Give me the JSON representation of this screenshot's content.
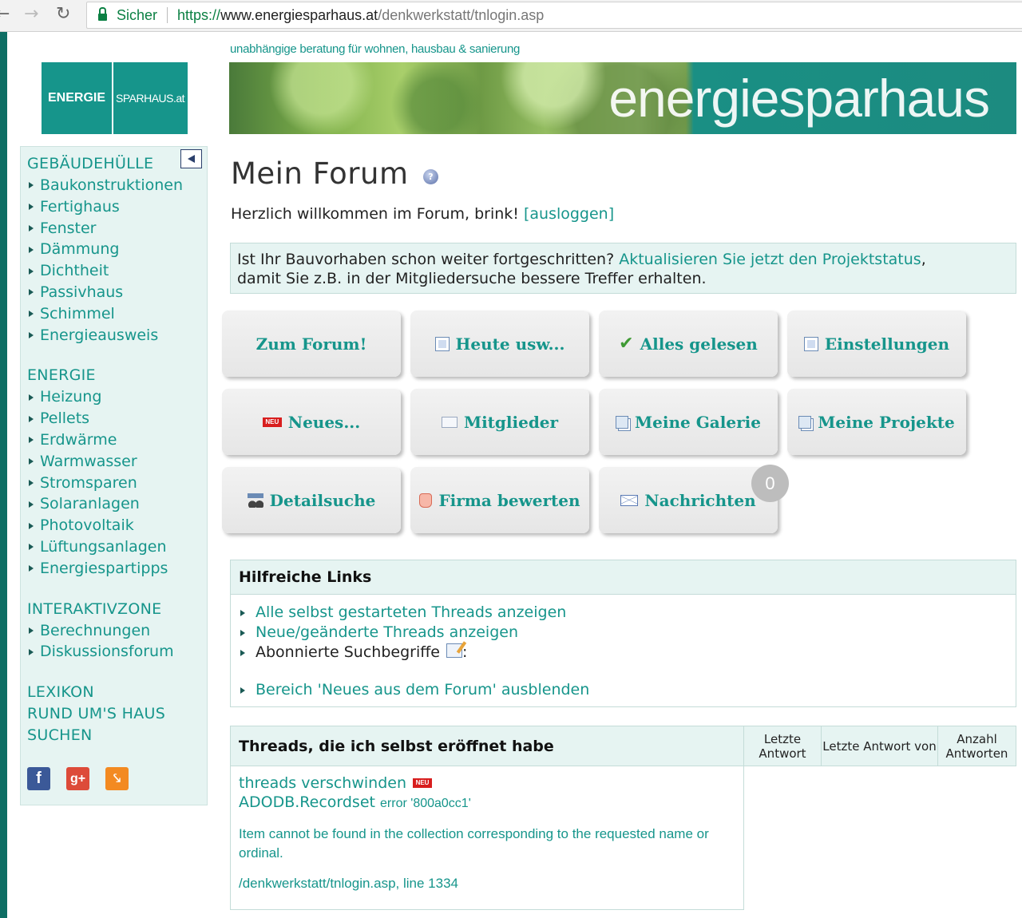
{
  "browser": {
    "secure_label": "Sicher",
    "url_scheme": "https://",
    "url_host": "www.energiesparhaus.at",
    "url_path": "/denkwerkstatt/tnlogin.asp"
  },
  "header": {
    "logo_left": "ENERGIE",
    "logo_right": "SPARHAUS.at",
    "tagline": "unabhängige beratung für wohnen, hausbau & sanierung",
    "banner_text": "energiesparhaus"
  },
  "sidebar": {
    "sections": [
      {
        "title": "GEBÄUDEHÜLLE",
        "items": [
          "Baukonstruktionen",
          "Fertighaus",
          "Fenster",
          "Dämmung",
          "Dichtheit",
          "Passivhaus",
          "Schimmel",
          "Energieausweis"
        ]
      },
      {
        "title": "ENERGIE",
        "items": [
          "Heizung",
          "Pellets",
          "Erdwärme",
          "Warmwasser",
          "Stromsparen",
          "Solaranlagen",
          "Photovoltaik",
          "Lüftungsanlagen",
          "Energiespartipps"
        ]
      },
      {
        "title": "INTERAKTIVZONE",
        "items": [
          "Berechnungen",
          "Diskussionsforum"
        ]
      }
    ],
    "plain_links": [
      "LEXIKON",
      "RUND UM'S HAUS",
      "SUCHEN"
    ],
    "social": {
      "facebook": "f",
      "google_plus": "g+",
      "rss": "rss"
    }
  },
  "main": {
    "title": "Mein Forum",
    "welcome_text": "Herzlich willkommen im Forum, brink!",
    "logout_label": "[ausloggen]",
    "notice_prefix": "Ist Ihr Bauvorhaben schon weiter fortgeschritten?",
    "notice_link": "Aktualisieren Sie jetzt den Projektstatus",
    "notice_suffix": ",",
    "notice_line2": "damit Sie z.B. in der Mitgliedersuche bessere Treffer erhalten.",
    "buttons": [
      {
        "label": "Zum Forum!",
        "icon": "none"
      },
      {
        "label": "Heute usw...",
        "icon": "document-icon"
      },
      {
        "label": "Alles gelesen",
        "icon": "check-icon"
      },
      {
        "label": "Einstellungen",
        "icon": "edit-icon"
      },
      {
        "label": "Neues...",
        "icon": "new-badge-icon"
      },
      {
        "label": "Mitglieder",
        "icon": "member-card-icon"
      },
      {
        "label": "Meine Galerie",
        "icon": "gallery-icon"
      },
      {
        "label": "Meine Projekte",
        "icon": "projects-icon"
      },
      {
        "label": "Detailsuche",
        "icon": "binoculars-icon"
      },
      {
        "label": "Firma bewerten",
        "icon": "thumbs-up-icon"
      },
      {
        "label": "Nachrichten",
        "icon": "mail-icon"
      }
    ],
    "messages_count": "0",
    "new_badge_text": "NEU",
    "helpful_links": {
      "title": "Hilfreiche Links",
      "items": [
        "Alle selbst gestarteten Threads anzeigen",
        "Neue/geänderte Threads anzeigen",
        "Abonnierte Suchbegriffe",
        "Bereich 'Neues aus dem Forum' ausblenden"
      ],
      "colon": ":"
    },
    "threads": {
      "title": "Threads, die ich selbst eröffnet habe",
      "col_last_reply": "Letzte Antwort",
      "col_last_reply_by": "Letzte Antwort von",
      "col_reply_count": "Anzahl Antworten",
      "thread_title": "threads verschwinden",
      "error_title": "ADODB.Recordset",
      "error_code": "error '800a0cc1'",
      "error_message": "Item cannot be found in the collection corresponding to the requested name or ordinal.",
      "error_location": "/denkwerkstatt/tnlogin.asp, line 1334"
    }
  },
  "colors": {
    "accent": "#16958b",
    "panel_bg": "#e6f4f2",
    "dark_bar": "#0e6e64"
  }
}
